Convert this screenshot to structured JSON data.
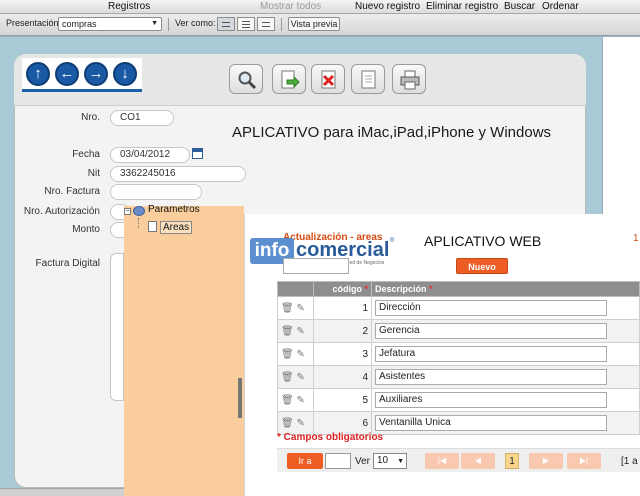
{
  "menubar": {
    "registros": "Registros",
    "mostrar_todos": "Mostrar todos",
    "nuevo_registro": "Nuevo registro",
    "eliminar_registro": "Eliminar registro",
    "buscar": "Buscar",
    "ordenar": "Ordenar"
  },
  "toolbar": {
    "presentacion_label": "Presentación:",
    "presentacion_value": "compras",
    "ver_como_label": "Ver como:",
    "vista_previa": "Vista previa"
  },
  "form": {
    "title": "APLICATIVO para iMac,iPad,iPhone y Windows",
    "nro_label": "Nro.",
    "nro_value": "CO1",
    "fecha_label": "Fecha",
    "fecha_value": "03/04/2012",
    "nit_label": "Nit",
    "nit_value": "3362245016",
    "nro_factura_label": "Nro. Factura",
    "nro_factura_value": "",
    "nro_autorizacion_label": "Nro. Autorización",
    "monto_label": "Monto",
    "factura_digital_label": "Factura Digital"
  },
  "tree": {
    "parent": "Parametros",
    "child": "Areas",
    "expand_glyph": "−"
  },
  "logo": {
    "info": "info",
    "comercial": "comercial",
    "registered": "®",
    "tagline": "Red de Negocios"
  },
  "webapp": {
    "section_title": "Actualización - areas",
    "app_title": "APLICATIVO WEB",
    "corner_number": "1",
    "nuevo_button": "Nuevo",
    "col_codigo": "código",
    "col_descripcion": "Descripción",
    "required_mark": "*",
    "rows": [
      {
        "codigo": "1",
        "descripcion": "Dirección"
      },
      {
        "codigo": "2",
        "descripcion": "Gerencia"
      },
      {
        "codigo": "3",
        "descripcion": "Jefatura"
      },
      {
        "codigo": "4",
        "descripcion": "Asistentes"
      },
      {
        "codigo": "5",
        "descripcion": "Auxiliares"
      },
      {
        "codigo": "6",
        "descripcion": "Ventanilla Unica"
      }
    ],
    "required_note": "* Campos obligatorios",
    "ira_button": "Ir a",
    "ver_label": "Ver",
    "rows_per_page": "10",
    "current_page": "1",
    "pager_info": "[1 a"
  },
  "icons": {
    "arrow_up": "↑",
    "arrow_left": "←",
    "arrow_right": "→",
    "arrow_down": "↓",
    "trash": "🗑",
    "edit": "✎",
    "first": "|◀",
    "prev": "◀",
    "next": "▶",
    "last": "▶|",
    "caret": "▼"
  },
  "colors": {
    "accent_orange": "#ee5e24",
    "nav_blue": "#1a59a3",
    "tree_bg": "#f9cd9c",
    "canvas_bg": "#aac9d6"
  }
}
